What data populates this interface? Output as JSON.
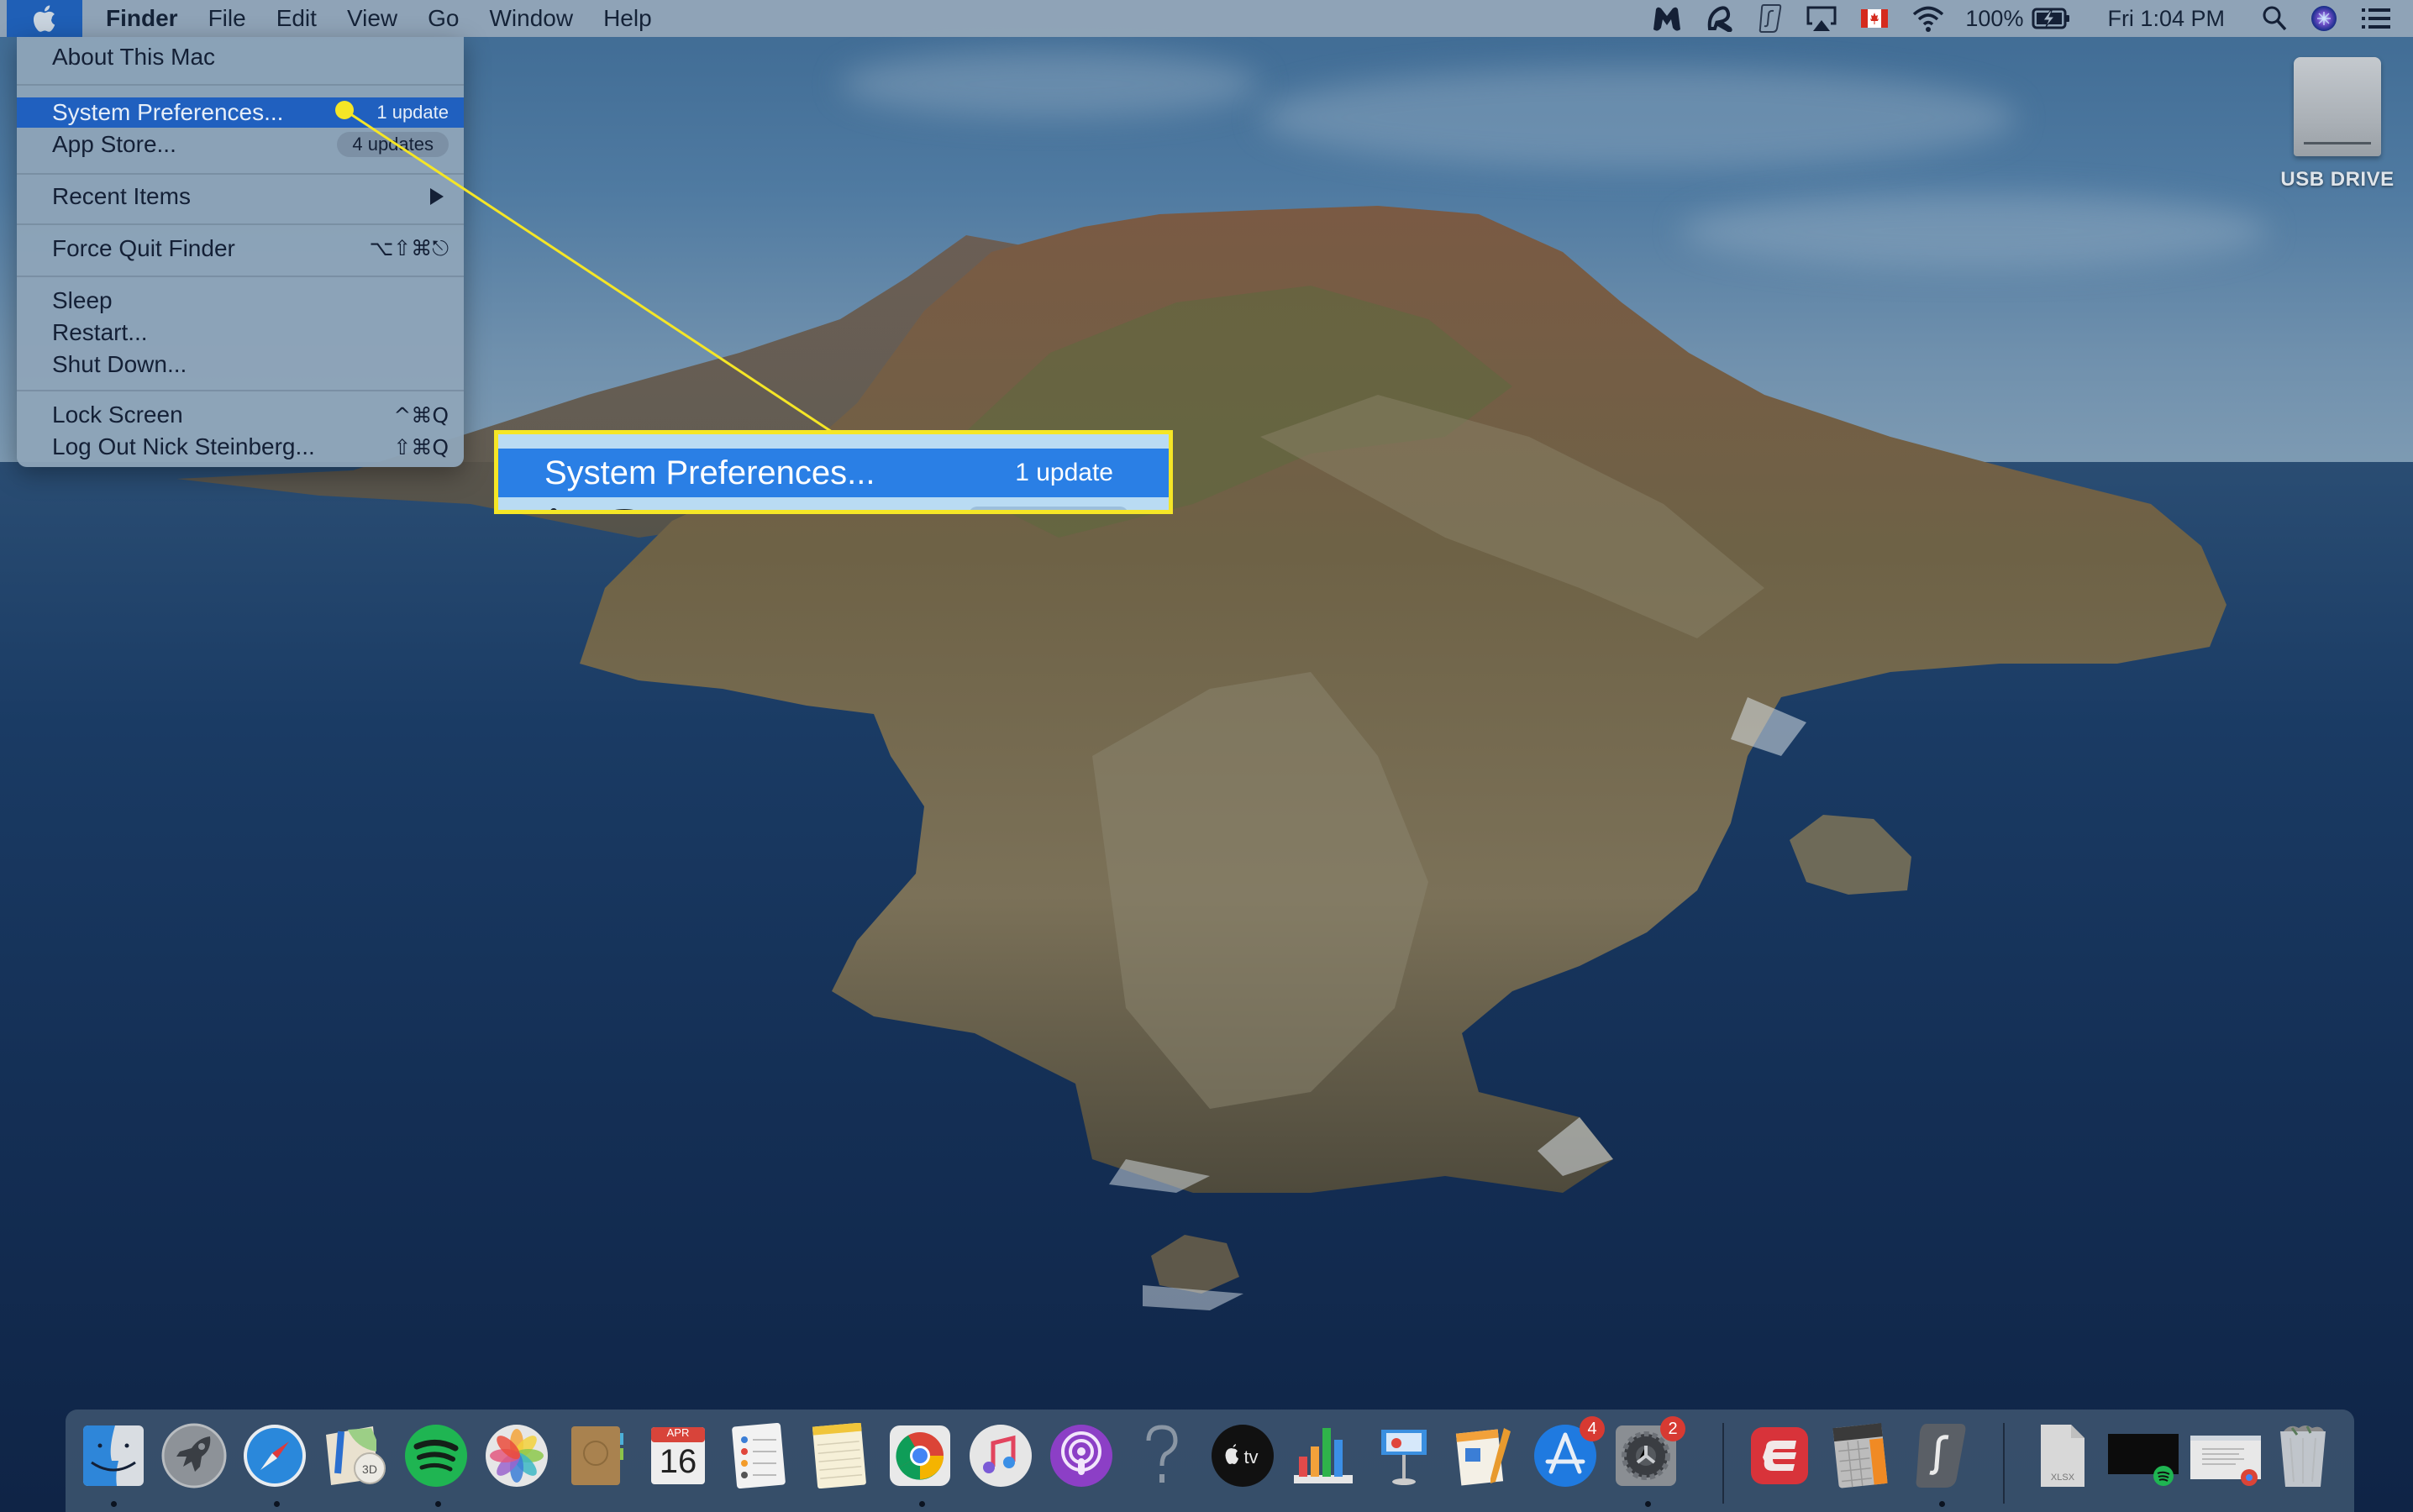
{
  "menubar": {
    "apple_icon": "apple-logo-icon",
    "app_name": "Finder",
    "menus": [
      "File",
      "Edit",
      "View",
      "Go",
      "Window",
      "Help"
    ],
    "status_icons": [
      "malwarebytes-icon",
      "avira-icon",
      "surfshark-icon",
      "airplay-icon",
      "canada-flag-icon",
      "wifi-icon"
    ],
    "battery_percent": "100%",
    "battery_icon": "battery-charging-icon",
    "clock": "Fri 1:04 PM",
    "right_icons": [
      "spotlight-search-icon",
      "siri-icon",
      "notification-center-icon"
    ]
  },
  "apple_menu": {
    "items": [
      {
        "label": "About This Mac"
      },
      {
        "label": "System Preferences...",
        "badge": "1 update",
        "highlighted": true
      },
      {
        "label": "App Store...",
        "badge": "4 updates"
      },
      {
        "label": "Recent Items",
        "submenu": true
      },
      {
        "label": "Force Quit Finder",
        "shortcut": "⌥⇧⌘⎋"
      },
      {
        "label": "Sleep"
      },
      {
        "label": "Restart..."
      },
      {
        "label": "Shut Down..."
      },
      {
        "label": "Lock Screen",
        "shortcut": "^⌘Q"
      },
      {
        "label": "Log Out Nick Steinberg...",
        "shortcut": "⇧⌘Q"
      }
    ]
  },
  "callout": {
    "label": "System Preferences...",
    "badge": "1 update",
    "accent": "#f5e626"
  },
  "desktop": {
    "usb_drive_label": "USB DRIVE"
  },
  "dock": {
    "apps": [
      {
        "name": "Finder",
        "running": true
      },
      {
        "name": "Launchpad",
        "running": false
      },
      {
        "name": "Safari",
        "running": true
      },
      {
        "name": "Maps",
        "running": false
      },
      {
        "name": "Spotify",
        "running": true
      },
      {
        "name": "Photos",
        "running": false
      },
      {
        "name": "Contacts",
        "running": false
      },
      {
        "name": "Calendar",
        "month": "APR",
        "day": "16",
        "running": false
      },
      {
        "name": "Reminders",
        "running": false
      },
      {
        "name": "Notes",
        "running": false
      },
      {
        "name": "Google Chrome",
        "running": true
      },
      {
        "name": "iTunes",
        "running": false
      },
      {
        "name": "Podcasts",
        "running": false
      },
      {
        "name": "Unknown App",
        "running": false
      },
      {
        "name": "Apple TV",
        "label": "tv",
        "running": false
      },
      {
        "name": "Numbers",
        "running": false
      },
      {
        "name": "Keynote",
        "running": false
      },
      {
        "name": "Pages",
        "running": false
      },
      {
        "name": "App Store",
        "badge": "4",
        "running": false
      },
      {
        "name": "System Preferences",
        "badge": "2",
        "running": true
      },
      {
        "name": "ExpressVPN",
        "running": false
      },
      {
        "name": "Calculator",
        "running": false
      },
      {
        "name": "Surfshark",
        "running": true
      }
    ],
    "stacks": [
      {
        "name": "XLSX Document",
        "label": "XLSX"
      },
      {
        "name": "Spotify Window",
        "running": false
      },
      {
        "name": "Chrome Document Window",
        "running": false
      },
      {
        "name": "Trash"
      }
    ]
  }
}
